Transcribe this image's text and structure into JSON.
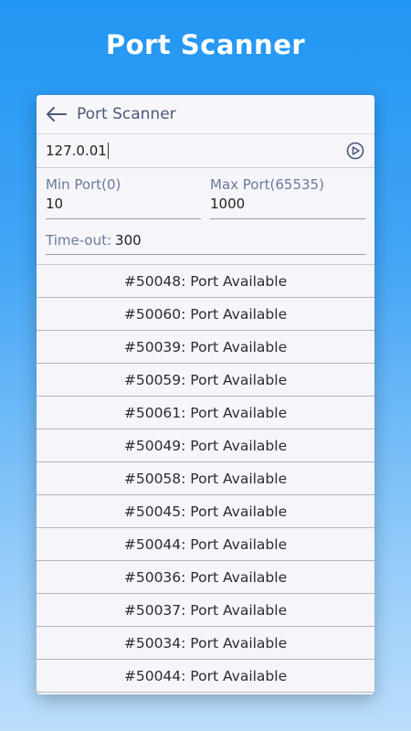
{
  "promo": {
    "title": "Port Scanner"
  },
  "appbar": {
    "back_icon": "arrow-left-icon",
    "title": "Port Scanner"
  },
  "host": {
    "value": "127.0.01",
    "go_icon": "play-circle-icon"
  },
  "ports": {
    "min_label": "Min Port(0)",
    "min_value": "10",
    "max_label": "Max Port(65535)",
    "max_value": "1000"
  },
  "timeout": {
    "label": "Time-out:",
    "value": "300"
  },
  "results": [
    "#50048: Port Available",
    "#50060: Port Available",
    "#50039: Port Available",
    "#50059: Port Available",
    "#50061: Port Available",
    "#50049: Port Available",
    "#50058: Port Available",
    "#50045: Port Available",
    "#50044: Port Available",
    "#50036: Port Available",
    "#50037: Port Available",
    "#50034: Port Available",
    "#50044: Port Available"
  ],
  "colors": {
    "accent": "#2196f3",
    "label": "#6b7a9c"
  }
}
